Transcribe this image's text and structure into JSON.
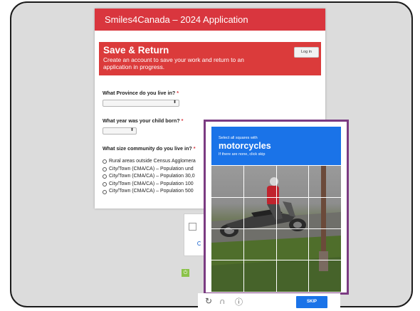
{
  "form": {
    "header_title": "Smiles4Canada – 2024 Application",
    "save_return": {
      "title": "Save & Return",
      "description": "Create an account to save your work and return to an application in progress.",
      "login_label": "Log in"
    },
    "questions": {
      "province": {
        "label": "What Province do you live in?",
        "required_mark": "*",
        "selected_value": ""
      },
      "birth_year": {
        "label": "What year was your child born?",
        "required_mark": "*",
        "selected_value": ""
      },
      "community_size": {
        "label": "What size community do you live in?",
        "required_mark": "*",
        "options": [
          "Rural areas outside Census Agglomera",
          "City/Town (CMA/CA) – Population und",
          "City/Town (CMA/CA) – Population 30,0",
          "City/Town (CMA/CA) – Population 100",
          "City/Town (CMA/CA) – Population 500"
        ]
      }
    }
  },
  "captcha": {
    "instruction": "Select all squares with",
    "target": "motorcycles",
    "hint": "If there are none, click skip",
    "grid_size": [
      4,
      4
    ],
    "skip_label": "SKIP",
    "footer_icons": [
      "reload-icon",
      "audio-icon",
      "info-icon"
    ],
    "accent_color": "#1a73e8",
    "highlight_border_color": "#7b3b82"
  },
  "colors": {
    "brand_red": "#d9363e"
  }
}
